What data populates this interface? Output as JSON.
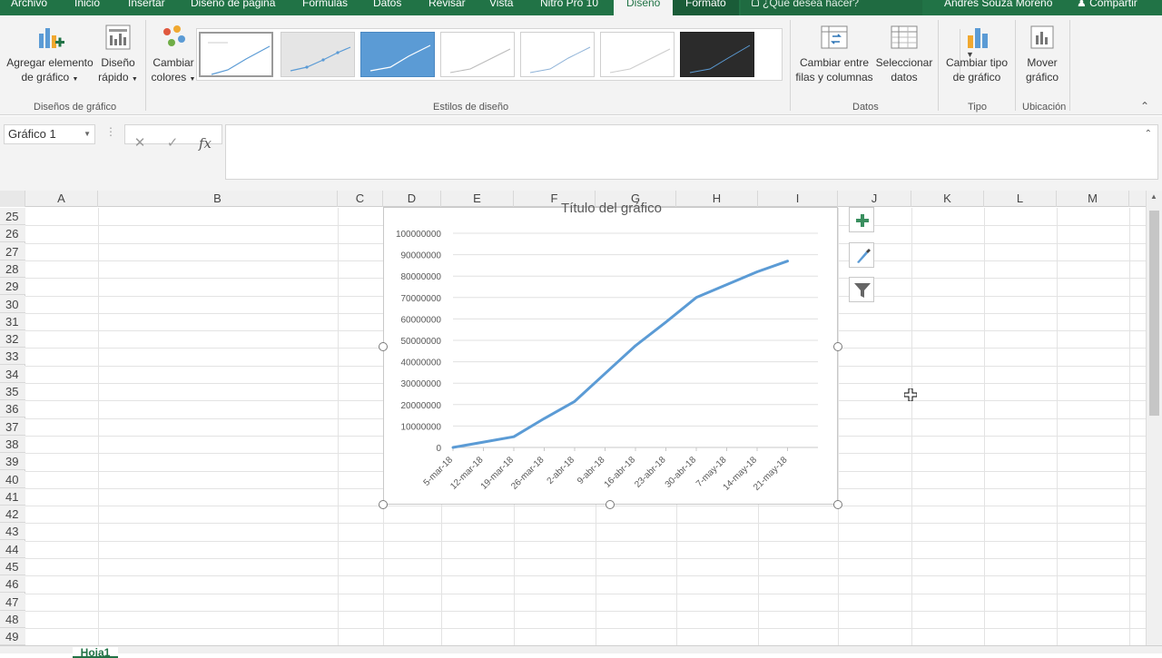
{
  "tabs": [
    {
      "label": "Archivo"
    },
    {
      "label": "Inicio"
    },
    {
      "label": "Insertar"
    },
    {
      "label": "Diseño de página"
    },
    {
      "label": "Fórmulas"
    },
    {
      "label": "Datos"
    },
    {
      "label": "Revisar"
    },
    {
      "label": "Vista"
    },
    {
      "label": "Nitro Pro 10"
    },
    {
      "label": "Diseño"
    },
    {
      "label": "Formato"
    }
  ],
  "tell_me": "¿Qué desea hacer?",
  "user": "Andrés Souza Moreno",
  "share_label": "Compartir",
  "ribbon": {
    "add_element": {
      "line1": "Agregar elemento",
      "line2": "de gráfico"
    },
    "quick_layout": {
      "line1": "Diseño",
      "line2": "rápido"
    },
    "change_colors": {
      "line1": "Cambiar",
      "line2": "colores"
    },
    "layouts_group": "Diseños de gráfico",
    "styles_group": "Estilos de diseño",
    "switch_rows": {
      "line1": "Cambiar entre",
      "line2": "filas y columnas"
    },
    "select_data": {
      "line1": "Seleccionar",
      "line2": "datos"
    },
    "data_group": "Datos",
    "change_type": {
      "line1": "Cambiar tipo",
      "line2": "de gráfico"
    },
    "type_group": "Tipo",
    "move_chart": {
      "line1": "Mover",
      "line2": "gráfico"
    },
    "location_group": "Ubicación"
  },
  "namebox": "Gráfico 1",
  "fx_label": "fx",
  "columns": [
    "A",
    "B",
    "C",
    "D",
    "E",
    "F",
    "G",
    "H",
    "I",
    "J",
    "K",
    "L",
    "M"
  ],
  "rows": [
    "25",
    "26",
    "27",
    "28",
    "29",
    "30",
    "31",
    "32",
    "33",
    "34",
    "35",
    "36",
    "37",
    "38",
    "39",
    "40",
    "41",
    "42",
    "43",
    "44",
    "45",
    "46",
    "47",
    "48",
    "49"
  ],
  "sheet_tab": "Hoja1",
  "colors": {
    "excel_green": "#217346",
    "series": "#5B9BD5"
  },
  "chart_data": {
    "type": "line",
    "title": "Título del gráfico",
    "x": [
      "5-mar-18",
      "12-mar-18",
      "19-mar-18",
      "26-mar-18",
      "2-abr-18",
      "9-abr-18",
      "16-abr-18",
      "23-abr-18",
      "30-abr-18",
      "7-may-18",
      "14-may-18",
      "21-may-18"
    ],
    "y_ticks": [
      "100000000",
      "90000000",
      "80000000",
      "70000000",
      "60000000",
      "50000000",
      "40000000",
      "30000000",
      "20000000",
      "10000000",
      "0"
    ],
    "series": [
      {
        "values": [
          0,
          2500000,
          5000000,
          13500000,
          21500000,
          34500000,
          47500000,
          58500000,
          70000000,
          76000000,
          82000000,
          87000000
        ]
      }
    ],
    "ylim": [
      0,
      100000000
    ],
    "grid": true,
    "legend": "none"
  }
}
